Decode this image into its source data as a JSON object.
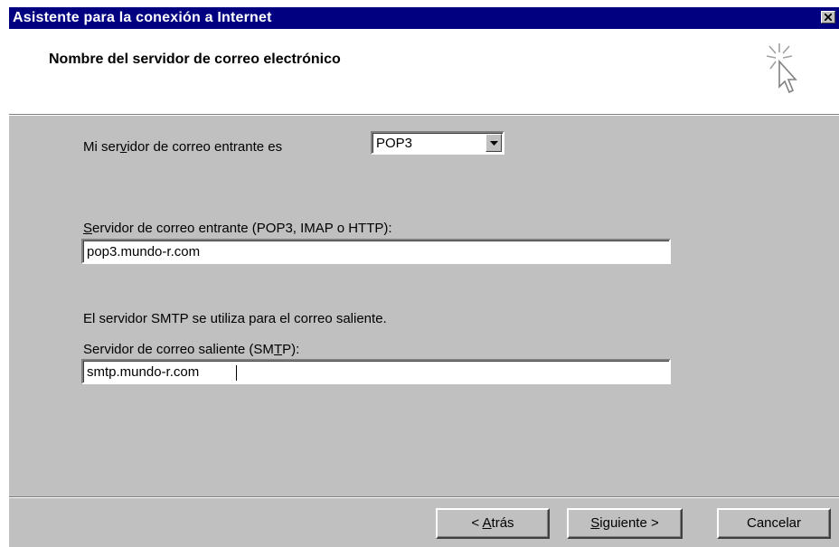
{
  "window": {
    "title": "Asistente para la conexión a Internet"
  },
  "header": {
    "title": "Nombre del servidor de correo electrónico",
    "icon": "wizard-cursor-sparkle-icon"
  },
  "form": {
    "incoming_type": {
      "label_pre": "Mi ser",
      "label_accel": "v",
      "label_post": "idor de correo entrante es",
      "selected": "POP3"
    },
    "incoming_server": {
      "label_accel": "S",
      "label_post": "ervidor de correo entrante (POP3, IMAP o HTTP):",
      "value": "pop3.mundo-r.com"
    },
    "smtp_note": "El servidor SMTP se utiliza para el correo saliente.",
    "outgoing_server": {
      "label_pre": "Servidor de correo saliente (SM",
      "label_accel": "T",
      "label_post": "P):",
      "value": "smtp.mundo-r.com"
    }
  },
  "buttons": {
    "back_pre": "< ",
    "back_accel": "A",
    "back_post": "trás",
    "next_accel": "S",
    "next_post": "iguiente >",
    "cancel": "Cancelar"
  }
}
